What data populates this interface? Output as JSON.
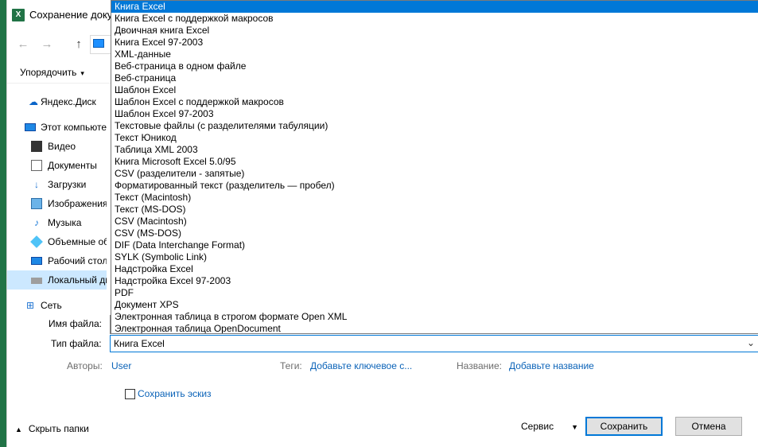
{
  "window": {
    "title": "Сохранение доку",
    "app_icon": "excel-icon"
  },
  "nav": {
    "back_icon": "←",
    "forward_icon": "→",
    "up_icon": "↑"
  },
  "toolbar": {
    "organize_label": "Упорядочить",
    "caret": "▾"
  },
  "sidebar": {
    "items": [
      {
        "label": "Яндекс.Диск",
        "icon": "yandex-disk-icon",
        "glyph": "☁",
        "icon_class": "ico-disk"
      },
      {
        "label": "Этот компьютер",
        "icon": "computer-icon",
        "glyph": "",
        "icon_class": "ico-pc"
      },
      {
        "label": "Видео",
        "icon": "video-icon",
        "glyph": "",
        "icon_class": "ico-video"
      },
      {
        "label": "Документы",
        "icon": "documents-icon",
        "glyph": "",
        "icon_class": "ico-doc"
      },
      {
        "label": "Загрузки",
        "icon": "downloads-icon",
        "glyph": "↓",
        "icon_class": "ico-down"
      },
      {
        "label": "Изображения",
        "icon": "pictures-icon",
        "glyph": "",
        "icon_class": "ico-img"
      },
      {
        "label": "Музыка",
        "icon": "music-icon",
        "glyph": "♪",
        "icon_class": "ico-music"
      },
      {
        "label": "Объемные объекты",
        "icon": "3d-objects-icon",
        "glyph": "",
        "icon_class": "ico-3d"
      },
      {
        "label": "Рабочий стол",
        "icon": "desktop-icon",
        "glyph": "",
        "icon_class": "ico-desk"
      },
      {
        "label": "Локальный диск",
        "icon": "local-disk-icon",
        "glyph": "",
        "icon_class": "ico-local",
        "selected": true
      },
      {
        "label": "Сеть",
        "icon": "network-icon",
        "glyph": "⊞",
        "icon_class": "ico-net"
      }
    ]
  },
  "file_types": {
    "selected_index": 0,
    "options": [
      "Книга Excel",
      "Книга Excel с поддержкой макросов",
      "Двоичная книга Excel",
      "Книга Excel 97-2003",
      "XML-данные",
      "Веб-страница в одном файле",
      "Веб-страница",
      "Шаблон Excel",
      "Шаблон Excel с поддержкой макросов",
      "Шаблон Excel 97-2003",
      "Текстовые файлы (с разделителями табуляции)",
      "Текст Юникод",
      "Таблица XML 2003",
      "Книга Microsoft Excel 5.0/95",
      "CSV (разделители - запятые)",
      "Форматированный текст (разделитель — пробел)",
      "Текст (Macintosh)",
      "Текст (MS-DOS)",
      "CSV (Macintosh)",
      "CSV (MS-DOS)",
      "DIF (Data Interchange Format)",
      "SYLK (Symbolic Link)",
      "Надстройка Excel",
      "Надстройка Excel 97-2003",
      "PDF",
      "Документ XPS",
      "Электронная таблица в строгом формате Open XML",
      "Электронная таблица OpenDocument"
    ]
  },
  "form": {
    "filename_label": "Имя файла:",
    "filename_value": "",
    "filetype_label": "Тип файла:",
    "filetype_value": "Книга Excel",
    "chevron": "⌄"
  },
  "meta": {
    "authors_label": "Авторы:",
    "authors_value": "User",
    "tags_label": "Теги:",
    "tags_value": "Добавьте ключевое с...",
    "title_label": "Название:",
    "title_value": "Добавьте название"
  },
  "thumbnail": {
    "label": "Сохранить эскиз",
    "checked": false
  },
  "footer": {
    "hide_folders_label": "Скрыть папки",
    "hide_caret": "▲",
    "tools_label": "Сервис",
    "tools_caret": "▼",
    "save_label": "Сохранить",
    "cancel_label": "Отмена"
  }
}
